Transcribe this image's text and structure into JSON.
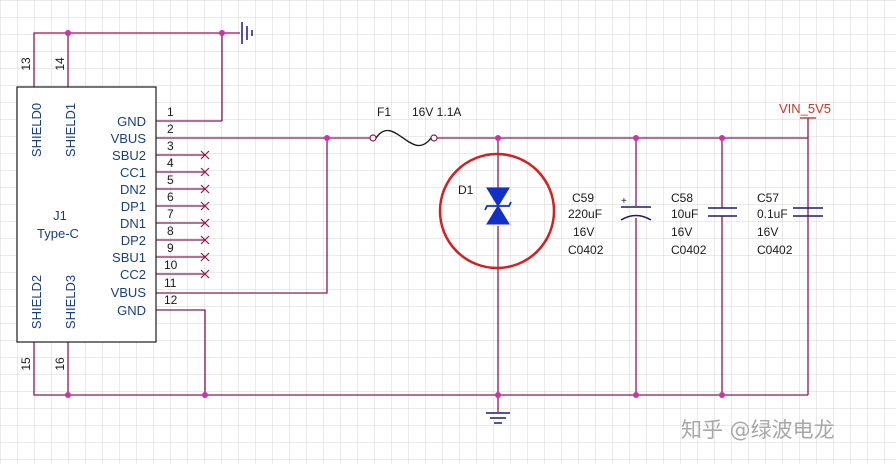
{
  "connector": {
    "ref": "J1",
    "type": "Type-C",
    "shields": [
      "SHIELD0",
      "SHIELD1",
      "SHIELD2",
      "SHIELD3"
    ],
    "shield_pins": [
      "13",
      "14",
      "15",
      "16"
    ],
    "pins": [
      {
        "num": "1",
        "name": "GND"
      },
      {
        "num": "2",
        "name": "VBUS"
      },
      {
        "num": "3",
        "name": "SBU2"
      },
      {
        "num": "4",
        "name": "CC1"
      },
      {
        "num": "5",
        "name": "DN2"
      },
      {
        "num": "6",
        "name": "DP1"
      },
      {
        "num": "7",
        "name": "DN1"
      },
      {
        "num": "8",
        "name": "DP2"
      },
      {
        "num": "9",
        "name": "SBU1"
      },
      {
        "num": "10",
        "name": "CC2"
      },
      {
        "num": "11",
        "name": "VBUS"
      },
      {
        "num": "12",
        "name": "GND"
      }
    ]
  },
  "fuse": {
    "ref": "F1",
    "value": "16V 1.1A"
  },
  "diode": {
    "ref": "D1"
  },
  "net_label": "VIN_5V5",
  "capacitors": [
    {
      "ref": "C59",
      "value": "220uF",
      "voltage": "16V",
      "package": "C0402",
      "polarity": "+"
    },
    {
      "ref": "C58",
      "value": "10uF",
      "voltage": "16V",
      "package": "C0402"
    },
    {
      "ref": "C57",
      "value": "0.1uF",
      "voltage": "16V",
      "package": "C0402"
    }
  ],
  "watermark": "知乎 @绿波电龙",
  "colors": {
    "wire": "#8b1a4f",
    "junction": "#cc33aa",
    "component": "#1c1c6e",
    "diode_fill": "#1030c8",
    "highlight": "#d42020",
    "net_label": "#c0392b",
    "grid": "#d4d4d4"
  }
}
